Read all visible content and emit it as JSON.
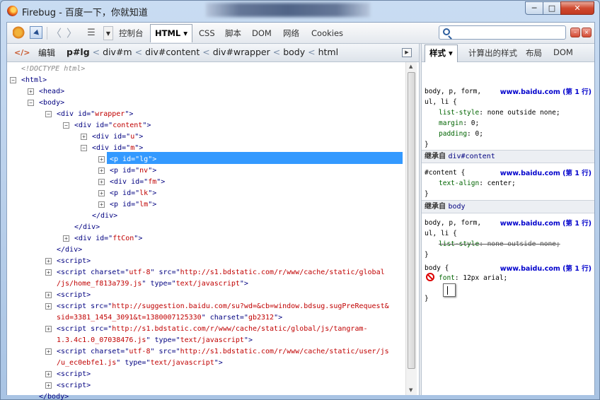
{
  "window": {
    "title": "Firebug - 百度一下，你就知道",
    "controls": {
      "minimize": "─",
      "maximize": "□",
      "close": "✕"
    }
  },
  "toolbar": {
    "menu_glyph": "☰",
    "menu_drop": "▼",
    "tabs": [
      {
        "label": "控制台"
      },
      {
        "label": "HTML ▾"
      },
      {
        "label": "CSS"
      },
      {
        "label": "脚本"
      },
      {
        "label": "DOM"
      },
      {
        "label": "网络"
      },
      {
        "label": "Cookies"
      }
    ],
    "search_placeholder": "",
    "btn_min": "–",
    "btn_close": "×"
  },
  "breadcrumb": {
    "edit_label": "编辑",
    "items": [
      "p#lg",
      "div#m",
      "div#content",
      "div#wrapper",
      "body",
      "html"
    ],
    "sep": "<"
  },
  "html_tree": {
    "doctype": "<!DOCTYPE html>",
    "lines": {
      "html": "<html>",
      "head": "<head>",
      "body": "<body>",
      "wrapper_open": "<div id=\"",
      "wrapper_id": "wrapper",
      "content_id": "content",
      "u_id": "u",
      "m_id": "m",
      "lg_id": "lg",
      "nv_id": "nv",
      "fm_id": "fm",
      "lk_id": "lk",
      "lm_id": "lm",
      "ftcon_id": "ftCon",
      "div_close": "</div>",
      "body_close": "</body>",
      "script": "<script>",
      "s1_src_a": "http://s1.bdstatic.com/r/www/cache/static/global",
      "s1_src_b": "/js/home_f813a739.js",
      "s2_src_a": "http://suggestion.baidu.com/su?wd=&cb=window.bdsug.sugPreRequest&",
      "s2_src_b": "sid=3381_1454_3091&t=1380007125330",
      "s3_src_a": "http://s1.bdstatic.com/r/www/cache/static/global/js/tangram-",
      "s3_src_b": "1.3.4c1.0_07038476.js",
      "s4_src_a": "http://s1.bdstatic.com/r/www/cache/static/user/js",
      "s4_src_b": "/u_ec0ebfe1.js",
      "charset_utf8": "utf-8",
      "charset_gb": "gb2312",
      "type_js": "text/javascript"
    }
  },
  "side_tabs": [
    "样式 ▾",
    "计算出的样式",
    "布局",
    "DOM"
  ],
  "styles": {
    "rule1_sel_a": "body, p, form,",
    "rule1_sel_b": "ul, li {",
    "rule1_src": "www.baidu.com (第 1 行)",
    "p_liststyle": "list-style",
    "v_liststyle": "none outside none;",
    "p_margin": "margin",
    "v_margin": "0;",
    "p_padding": "padding",
    "v_padding": "0;",
    "close": "}",
    "inherit1_label": "继承自",
    "inherit1_sel": "div#content",
    "rule2_sel": "#content {",
    "rule2_src": "www.baidu.com (第 1 行)",
    "p_textalign": "text-align",
    "v_textalign": "center;",
    "inherit2_label": "继承自",
    "inherit2_sel": "body",
    "rule3_sel_a": "body, p, form,",
    "rule3_sel_b": "ul, li {",
    "rule3_src": "www.baidu.com (第 1 行)",
    "rule4_sel": "body {",
    "rule4_src": "www.baidu.com (第 1 行)",
    "p_font": "font",
    "v_font": "12px arial;"
  }
}
